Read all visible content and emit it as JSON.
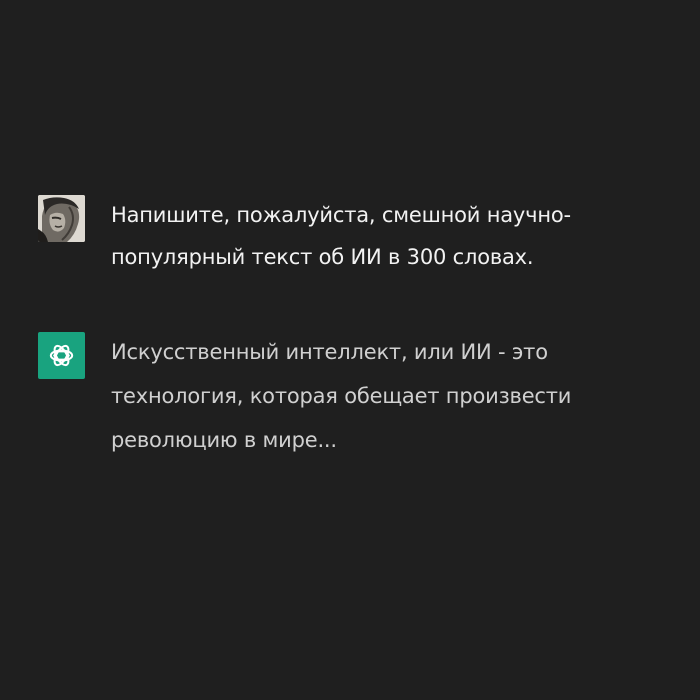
{
  "conversation": {
    "user_message": "Напишите, пожалуйста, смешной научно-популярный текст об ИИ в 300 словах.",
    "assistant_message": "Искусственный интеллект, или ИИ - это технология, которая обещает произвести революцию в мире...",
    "user_avatar_icon": "user-avatar-icon",
    "assistant_avatar_icon": "openai-logo-icon",
    "assistant_avatar_color": "#19a37f",
    "background_color": "#1f1f1f"
  }
}
